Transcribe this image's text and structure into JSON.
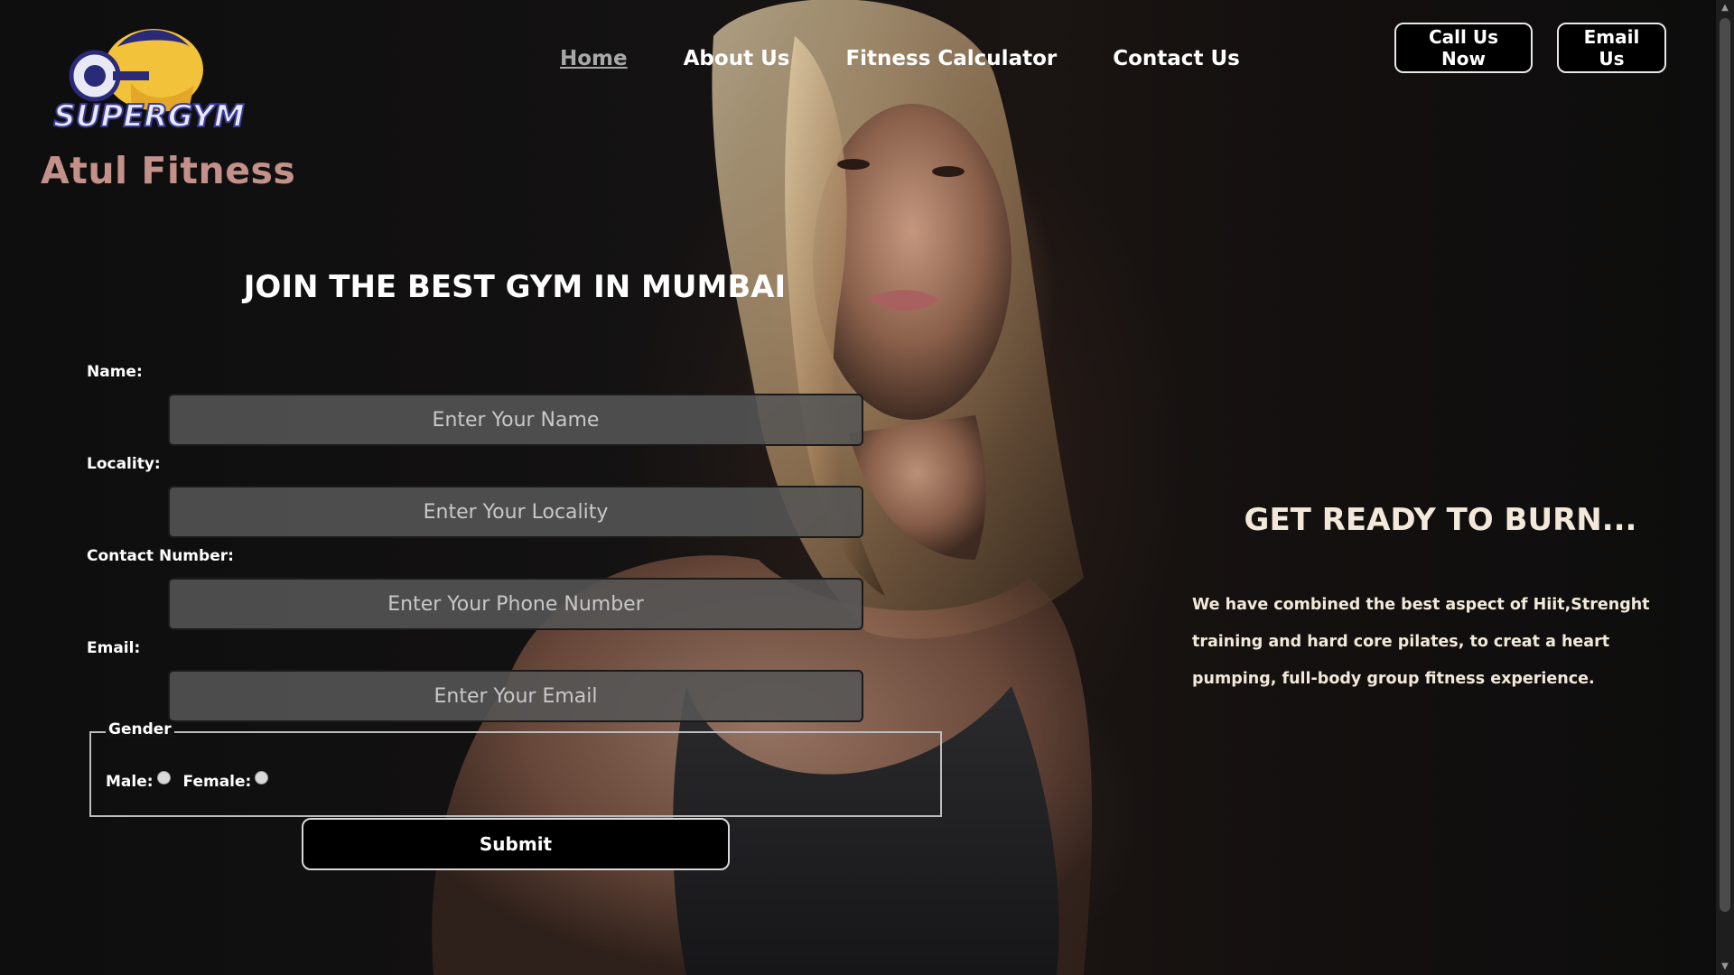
{
  "brand": {
    "logo_text": "SUPERGYM",
    "title": "Atul Fitness"
  },
  "nav": {
    "items": [
      {
        "label": "Home",
        "active": true
      },
      {
        "label": "About Us",
        "active": false
      },
      {
        "label": "Fitness Calculator",
        "active": false
      },
      {
        "label": "Contact Us",
        "active": false
      }
    ]
  },
  "header_buttons": {
    "call": "Call Us Now",
    "email": "Email Us"
  },
  "form": {
    "heading": "JOIN THE BEST GYM IN MUMBAI",
    "fields": [
      {
        "label": "Name:",
        "placeholder": "Enter Your Name"
      },
      {
        "label": "Locality:",
        "placeholder": "Enter Your Locality"
      },
      {
        "label": "Contact Number:",
        "placeholder": "Enter Your Phone Number"
      },
      {
        "label": "Email:",
        "placeholder": "Enter Your Email"
      }
    ],
    "gender": {
      "legend": "Gender",
      "male": "Male:",
      "female": "Female:"
    },
    "submit": "Submit"
  },
  "promo": {
    "heading": "GET READY TO BURN...",
    "text": "We have combined the best aspect of Hiit,Strenght training and hard core pilates, to creat a heart pumping, full-body group fitness experience."
  },
  "colors": {
    "brand_title": "#c4908a",
    "promo_text": "#f3e9da",
    "input_bg": "#555555"
  }
}
